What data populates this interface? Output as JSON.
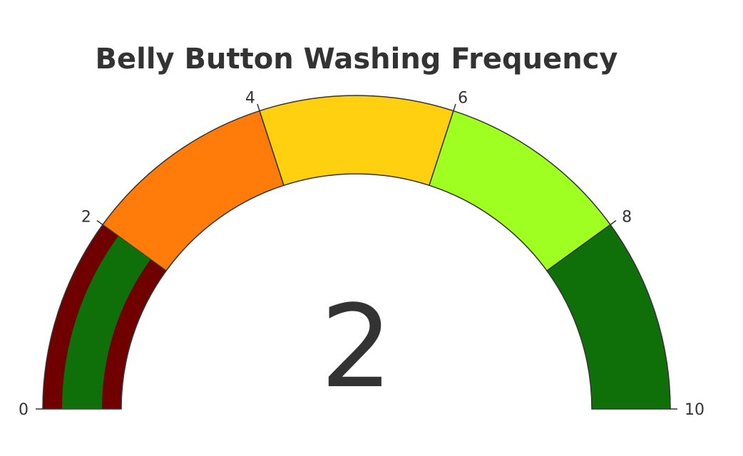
{
  "chart_data": {
    "type": "gauge",
    "title": "Belly Button Washing Frequency",
    "value": 2,
    "value_text": "2",
    "range": [
      0,
      10
    ],
    "tick_values": [
      0,
      2,
      4,
      6,
      8,
      10
    ],
    "tick_labels": [
      "0",
      "2",
      "4",
      "6",
      "8",
      "10"
    ],
    "steps": [
      {
        "range": [
          0,
          2
        ],
        "color": "#700000"
      },
      {
        "range": [
          2,
          4
        ],
        "color": "#ff7b0a"
      },
      {
        "range": [
          4,
          6
        ],
        "color": "#ffd010"
      },
      {
        "range": [
          6,
          8
        ],
        "color": "#9eff20"
      },
      {
        "range": [
          8,
          10
        ],
        "color": "#0f700a"
      }
    ],
    "bar": {
      "color": "#0f700a"
    }
  }
}
